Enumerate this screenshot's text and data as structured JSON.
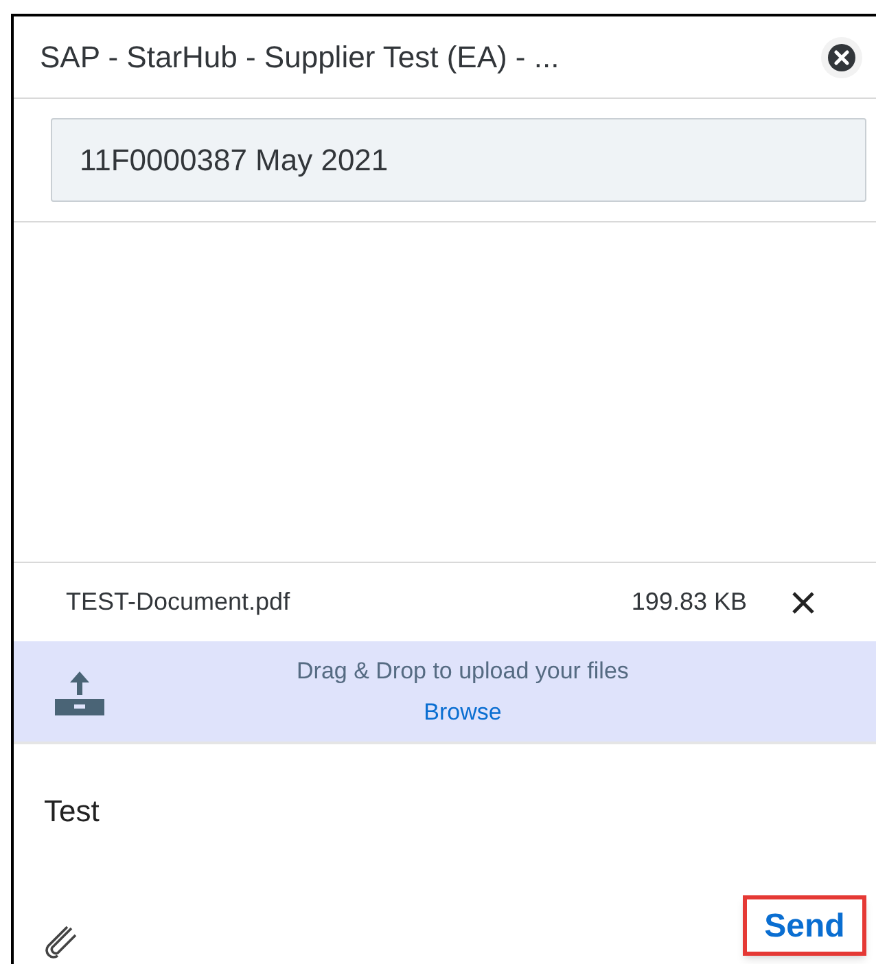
{
  "window": {
    "title": "SAP - StarHub - Supplier Test (EA) - ..."
  },
  "subject_field": {
    "value": "11F0000387 May 2021"
  },
  "attachment": {
    "name": "TEST-Document.pdf",
    "size": "199.83 KB"
  },
  "dropzone": {
    "text": "Drag & Drop to upload your files",
    "link": "Browse"
  },
  "message": {
    "value": "Test"
  },
  "send_button": {
    "label": "Send",
    "highlighted": true
  }
}
